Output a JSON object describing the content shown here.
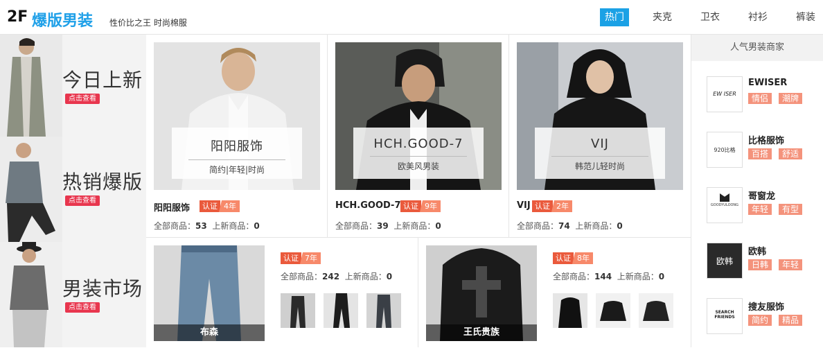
{
  "header": {
    "floor": "2F",
    "title": "爆版男装",
    "subtitle": "性价比之王 时尚棉服",
    "tabs": [
      {
        "label": "热门",
        "active": true
      },
      {
        "label": "夹克"
      },
      {
        "label": "卫衣"
      },
      {
        "label": "衬衫"
      },
      {
        "label": "裤装"
      }
    ]
  },
  "promos": [
    {
      "title": "今日上新",
      "button": "点击查看"
    },
    {
      "title": "热销爆版",
      "button": "点击查看"
    },
    {
      "title": "男装市场",
      "button": "点击查看"
    }
  ],
  "shops": [
    {
      "overlay_title": "阳阳服饰",
      "overlay_sub": "简约|年轻|时尚",
      "name": "阳阳服饰",
      "cert": "认证",
      "years": "4年",
      "all_label": "全部商品：",
      "all": "53",
      "new_label": "上新商品：",
      "new": "0"
    },
    {
      "overlay_title": "HCH.GOOD-7",
      "overlay_sub": "欧美风男装",
      "name": "HCH.GOOD-7",
      "cert": "认证",
      "years": "9年",
      "all_label": "全部商品：",
      "all": "39",
      "new_label": "上新商品：",
      "new": "0"
    },
    {
      "overlay_title": "VIJ",
      "overlay_sub": "韩范儿轻时尚",
      "name": "VIJ",
      "cert": "认证",
      "years": "2年",
      "all_label": "全部商品：",
      "all": "74",
      "new_label": "上新商品：",
      "new": "0"
    }
  ],
  "bottom_shops": [
    {
      "caption": "布森",
      "cert": "认证",
      "years": "7年",
      "all_label": "全部商品：",
      "all": "242",
      "new_label": "上新商品：",
      "new": "0"
    },
    {
      "caption": "王氏贵族",
      "cert": "认证",
      "years": "8年",
      "all_label": "全部商品：",
      "all": "144",
      "new_label": "上新商品：",
      "new": "0"
    }
  ],
  "merchants": {
    "heading": "人气男装商家",
    "items": [
      {
        "name": "EWISER",
        "logo": "EW ISER",
        "tags": [
          "情侣",
          "潮牌"
        ]
      },
      {
        "name": "比格服饰",
        "logo": "920比格",
        "tags": [
          "百搭",
          "舒适"
        ]
      },
      {
        "name": "哥窗龙",
        "logo": "GOODYULOONG",
        "tags": [
          "年轻",
          "有型"
        ]
      },
      {
        "name": "欧韩",
        "logo": "欧韩",
        "tags": [
          "日韩",
          "年轻"
        ]
      },
      {
        "name": "搜友服饰",
        "logo": "SEARCH FRIENDS",
        "tags": [
          "简约",
          "精品"
        ]
      }
    ]
  },
  "colors": {
    "accent": "#1ba1e5",
    "cert": "#ea5a3c",
    "tag": "#f4937c",
    "promo_button": "#e8364e"
  }
}
